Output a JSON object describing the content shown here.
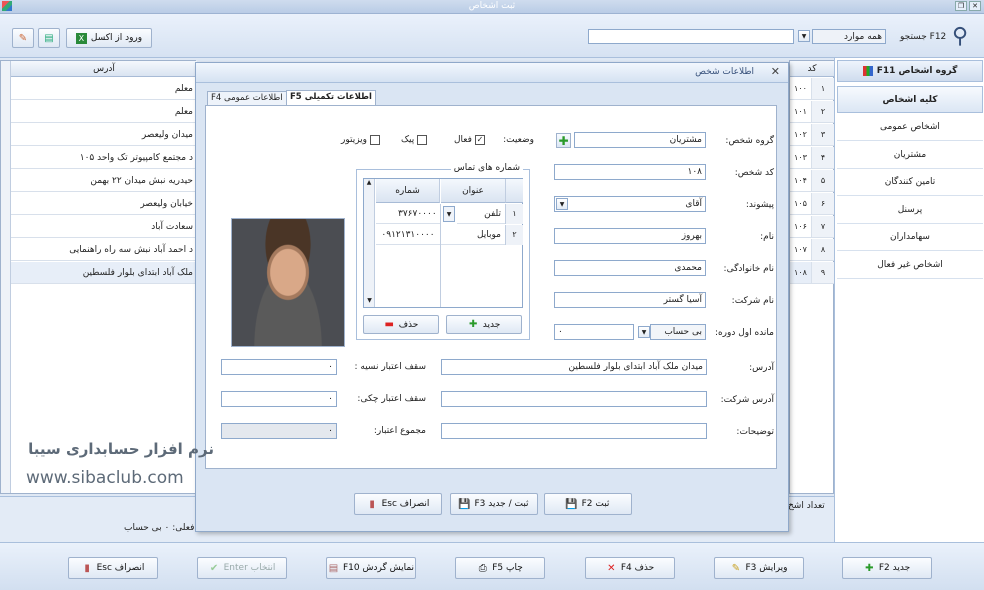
{
  "window": {
    "title": "ثبت اشخاص"
  },
  "toolbar": {
    "excel_label": "ورود از اکسل",
    "search_label": "جستجو F12",
    "search_value": "",
    "filter_value": "همه موارد"
  },
  "left_grid": {
    "header": "آدرس",
    "rows": [
      "معلم",
      "معلم",
      "میدان ولیعصر",
      "د مجتمع کامپیوتر تک واحد ۱۰۵",
      "حیدریه نبش میدان ۲۲ بهمن",
      "خیابان ولیعصر",
      "سعادت آباد",
      "د احمد آباد نبش سه راه راهنمایی",
      "ملک آباد ابتدای بلوار فلسطین"
    ]
  },
  "number_col": {
    "header": "کد",
    "rows": [
      [
        "۱",
        "۱۰۰"
      ],
      [
        "۲",
        "۱۰۱"
      ],
      [
        "۳",
        "۱۰۲"
      ],
      [
        "۴",
        "۱۰۳"
      ],
      [
        "۵",
        "۱۰۴"
      ],
      [
        "۶",
        "۱۰۵"
      ],
      [
        "۷",
        "۱۰۶"
      ],
      [
        "۸",
        "۱۰۷"
      ],
      [
        "۹",
        "۱۰۸"
      ]
    ]
  },
  "right_panel": {
    "header": "گروه اشخاص F11",
    "items": [
      "کلیه اشخاص",
      "اشخاص عمومی",
      "مشتریان",
      "تامین کنندگان",
      "پرسنل",
      "سهامداران",
      "اشخاص غیر فعال"
    ]
  },
  "status": {
    "count_label": "تعداد اشخ",
    "balance_label": "فعلی: ۰ بی حساب"
  },
  "dialog": {
    "title": "اطلاعات شخص",
    "tab_general": "اطلاعات عمومی F4",
    "tab_extra": "اطلاعات تکمیلی F5",
    "group_label": "گروه شخص:",
    "group_value": "مشتریان",
    "code_label": "کد شخص:",
    "code_value": "۱۰۸",
    "prefix_label": "پیشوند:",
    "prefix_value": "آقای",
    "name_label": "نام:",
    "name_value": "بهروز",
    "family_label": "نام خانوادگی:",
    "family_value": "محمدی",
    "company_label": "نام شرکت:",
    "company_value": "آسیا گستر",
    "balance_label": "مانده اول دوره:",
    "balance_type": "بی حساب",
    "balance_value": "۰",
    "status_label": "وضعیت:",
    "active_label": "فعال",
    "peak_label": "پیک",
    "visitor_label": "ویزیتور",
    "phones_label": "شماره های تماس",
    "phone_col_title": "عنوان",
    "phone_col_number": "شماره",
    "phones": [
      [
        "۱",
        "تلفن",
        "۳۷۶۷۰۰۰۰"
      ],
      [
        "۲",
        "موبایل",
        "۰۹۱۲۱۳۱۰۰۰۰"
      ]
    ],
    "new_label": "جدید",
    "delete_label": "حذف",
    "address_label": "آدرس:",
    "address_value": "میدان ملک آباد ابتدای بلوار فلسطین",
    "company_addr_label": "آدرس شرکت:",
    "company_addr_value": "",
    "notes_label": "توضیحات:",
    "notes_value": "",
    "credit_label": "سقف اعتبار نسیه :",
    "credit_value": "۰",
    "check_credit_label": "سقف اعتبار چکی:",
    "check_credit_value": "۰",
    "total_credit_label": "مجموع اعتبار:",
    "total_credit_value": "۰",
    "save_label": "ثبت F2",
    "save_new_label": "ثبت / جدید F3",
    "cancel_label": "انصراف Esc"
  },
  "watermark": {
    "line1": "نرم افزار حسابداری سیبا",
    "line2": "www.sibaclub.com"
  },
  "bottom": {
    "new": "جدید F2",
    "edit": "ویرایش F3",
    "delete": "حذف F4",
    "print": "چاپ F5",
    "turnover": "نمایش گردش F10",
    "select": "انتخاب Enter",
    "cancel": "انصراف Esc"
  }
}
